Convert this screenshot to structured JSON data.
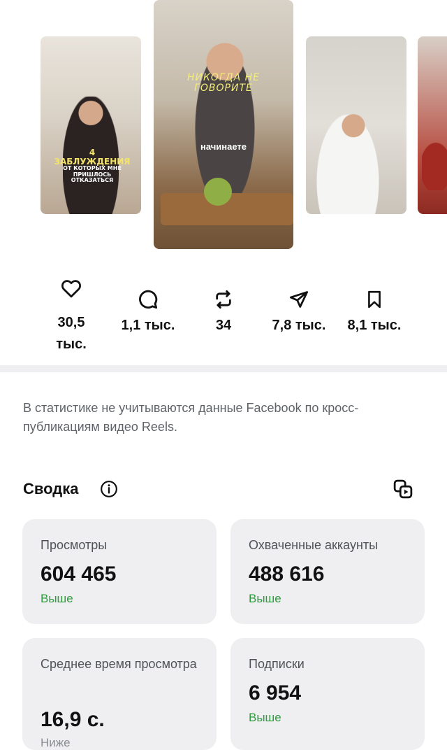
{
  "reels": {
    "thumb_1": {
      "caption_line_1": "4 ЗАБЛУЖДЕНИЯ",
      "caption_line_2": "ОТ КОТОРЫХ МНЕ ПРИШЛОСЬ ОТКАЗАТЬСЯ"
    },
    "thumb_2": {
      "caption_top": "НИКОГДА НЕ ГОВОРИТЕ",
      "caption_mid": "начинаете"
    }
  },
  "metrics": {
    "likes": "30,5 тыс.",
    "comments": "1,1 тыс.",
    "reposts": "34",
    "shares": "7,8 тыс.",
    "saves": "8,1 тыс."
  },
  "note": "В статистике не учитываются данные Facebook по кросс-публикациям видео Reels.",
  "summary": {
    "title": "Сводка",
    "cards": [
      {
        "label": "Просмотры",
        "value": "604 465",
        "trend": "Выше"
      },
      {
        "label": "Охваченные аккаунты",
        "value": "488 616",
        "trend": "Выше"
      },
      {
        "label": "Среднее время просмотра",
        "value": "16,9 с.",
        "trend": "Ниже"
      },
      {
        "label": "Подписки",
        "value": "6 954",
        "trend": "Выше"
      }
    ]
  },
  "colors": {
    "trend_up": "#2e9a3e",
    "card_bg": "#efeff1",
    "text_secondary": "#5f6368"
  }
}
